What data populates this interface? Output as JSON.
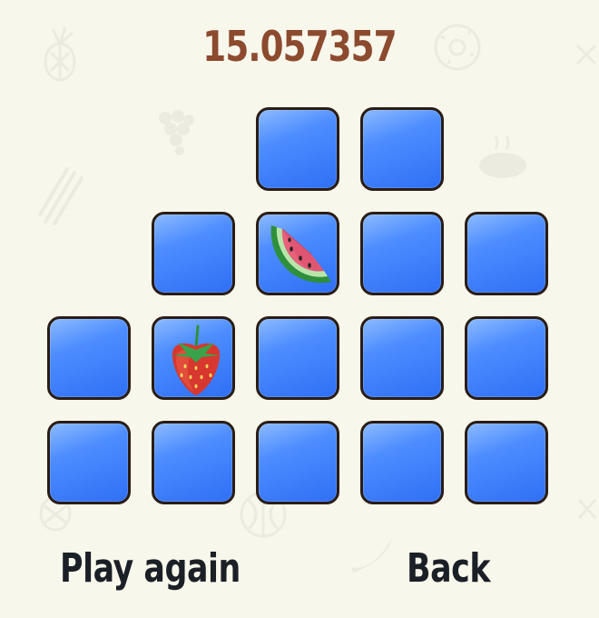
{
  "game": {
    "timer": "15.057357",
    "colors": {
      "background": "#f8f7ec",
      "timer_text": "#8c4a2e",
      "tile_face": "#4d8dff",
      "tile_border": "#2a1d14",
      "button_text": "#1b1f26"
    },
    "board": {
      "rows": [
        [
          {
            "state": "hidden"
          },
          {
            "state": "hidden"
          }
        ],
        [
          {
            "state": "hidden"
          },
          {
            "state": "revealed",
            "fruit": "watermelon-icon"
          },
          {
            "state": "hidden"
          },
          {
            "state": "hidden"
          }
        ],
        [
          {
            "state": "hidden"
          },
          {
            "state": "revealed",
            "fruit": "strawberry-icon"
          },
          {
            "state": "hidden"
          },
          {
            "state": "hidden"
          },
          {
            "state": "hidden"
          }
        ],
        [
          {
            "state": "hidden"
          },
          {
            "state": "hidden"
          },
          {
            "state": "hidden"
          },
          {
            "state": "hidden"
          },
          {
            "state": "hidden"
          }
        ]
      ]
    }
  },
  "buttons": {
    "play_again": "Play again",
    "back": "Back"
  }
}
